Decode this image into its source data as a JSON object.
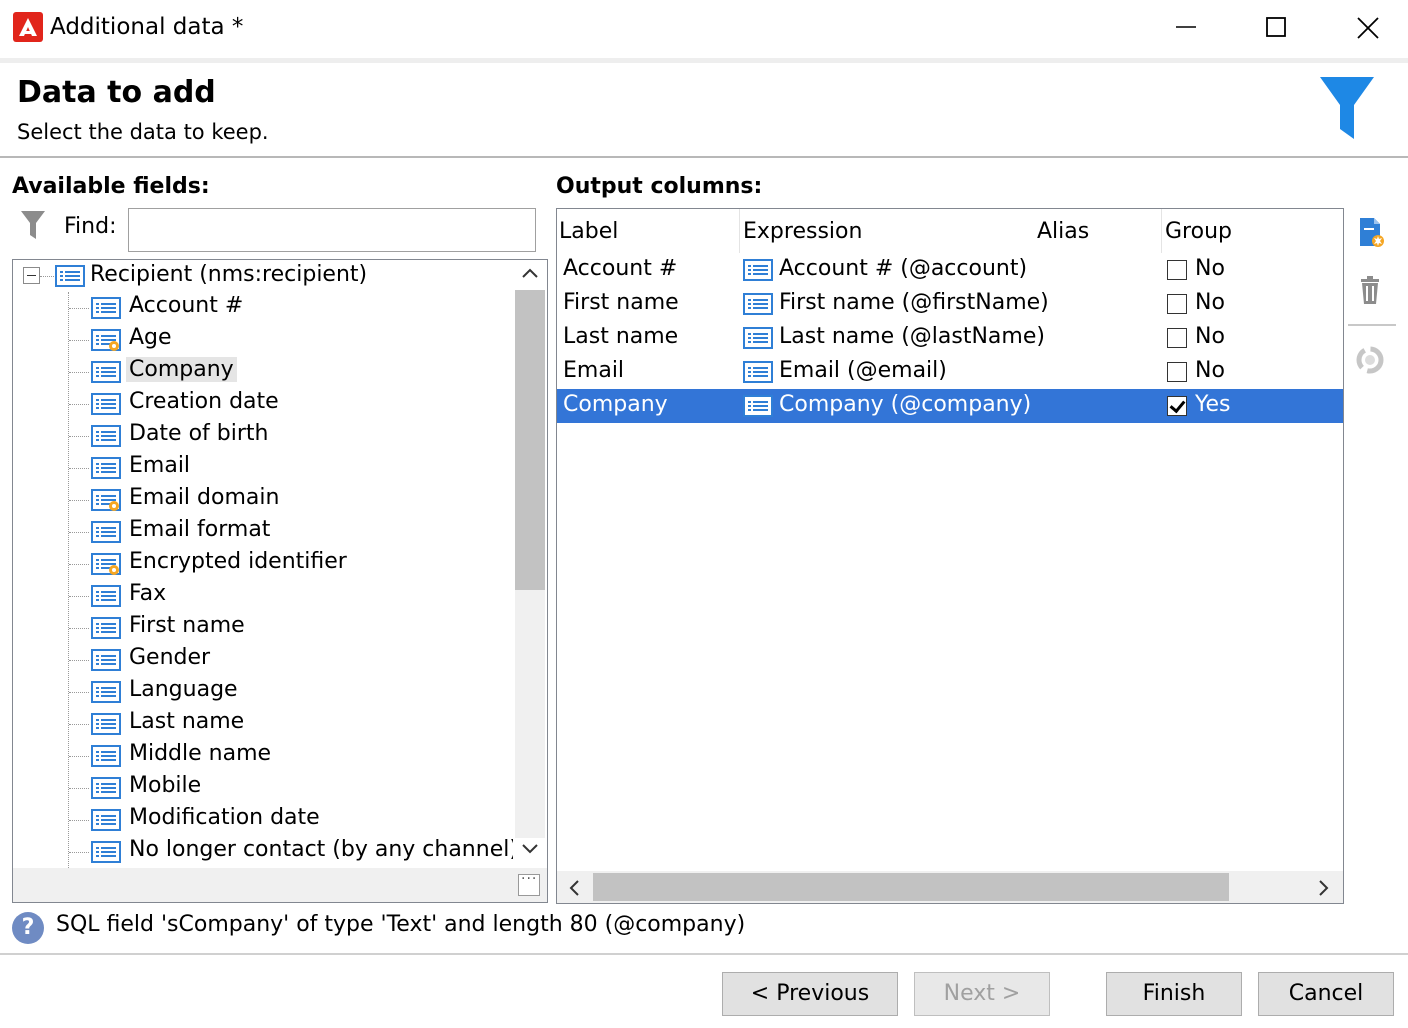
{
  "window": {
    "title": "Additional data *",
    "controls": [
      "minimize-icon",
      "maximize-icon",
      "close-icon"
    ]
  },
  "header": {
    "title": "Data to add",
    "subtitle": "Select the data to keep.",
    "icon": "filter-icon"
  },
  "available": {
    "label": "Available fields:",
    "find_label": "Find:",
    "find_value": "",
    "root": "Recipient (nms:recipient)",
    "items": [
      {
        "label": "Account #",
        "icon": "field-icon"
      },
      {
        "label": "Age",
        "icon": "computed-field-icon"
      },
      {
        "label": "Company",
        "icon": "field-icon",
        "highlighted": true
      },
      {
        "label": "Creation date",
        "icon": "field-icon"
      },
      {
        "label": "Date of birth",
        "icon": "field-icon"
      },
      {
        "label": "Email",
        "icon": "field-icon"
      },
      {
        "label": "Email domain",
        "icon": "computed-field-icon"
      },
      {
        "label": "Email format",
        "icon": "field-icon"
      },
      {
        "label": "Encrypted identifier",
        "icon": "computed-field-icon"
      },
      {
        "label": "Fax",
        "icon": "field-icon"
      },
      {
        "label": "First name",
        "icon": "field-icon"
      },
      {
        "label": "Gender",
        "icon": "field-icon"
      },
      {
        "label": "Language",
        "icon": "field-icon"
      },
      {
        "label": "Last name",
        "icon": "field-icon"
      },
      {
        "label": "Middle name",
        "icon": "field-icon"
      },
      {
        "label": "Mobile",
        "icon": "field-icon"
      },
      {
        "label": "Modification date",
        "icon": "field-icon"
      },
      {
        "label": "No longer contact (by any channel)",
        "icon": "field-icon"
      }
    ]
  },
  "output": {
    "label": "Output columns:",
    "columns": [
      "Label",
      "Expression",
      "Alias",
      "Group"
    ],
    "rows": [
      {
        "label": "Account #",
        "expression": "Account # (@account)",
        "group": "No",
        "checked": false,
        "selected": false
      },
      {
        "label": "First name",
        "expression": "First name (@firstName)",
        "group": "No",
        "checked": false,
        "selected": false
      },
      {
        "label": "Last name",
        "expression": "Last name (@lastName)",
        "group": "No",
        "checked": false,
        "selected": false
      },
      {
        "label": "Email",
        "expression": "Email (@email)",
        "group": "No",
        "checked": false,
        "selected": false
      },
      {
        "label": "Company",
        "expression": "Company (@company)",
        "group": "Yes",
        "checked": true,
        "selected": true
      }
    ]
  },
  "toolbar": {
    "icons": [
      "add-column-icon",
      "delete-icon",
      "refresh-icon"
    ]
  },
  "info": {
    "text": "SQL field 'sCompany' of type 'Text' and length 80 (@company)"
  },
  "buttons": {
    "previous": "< Previous",
    "next": "Next >",
    "finish": "Finish",
    "cancel": "Cancel"
  },
  "colors": {
    "selection": "#3375d7",
    "accent": "#1e88e5",
    "brand": "#e1251b"
  }
}
